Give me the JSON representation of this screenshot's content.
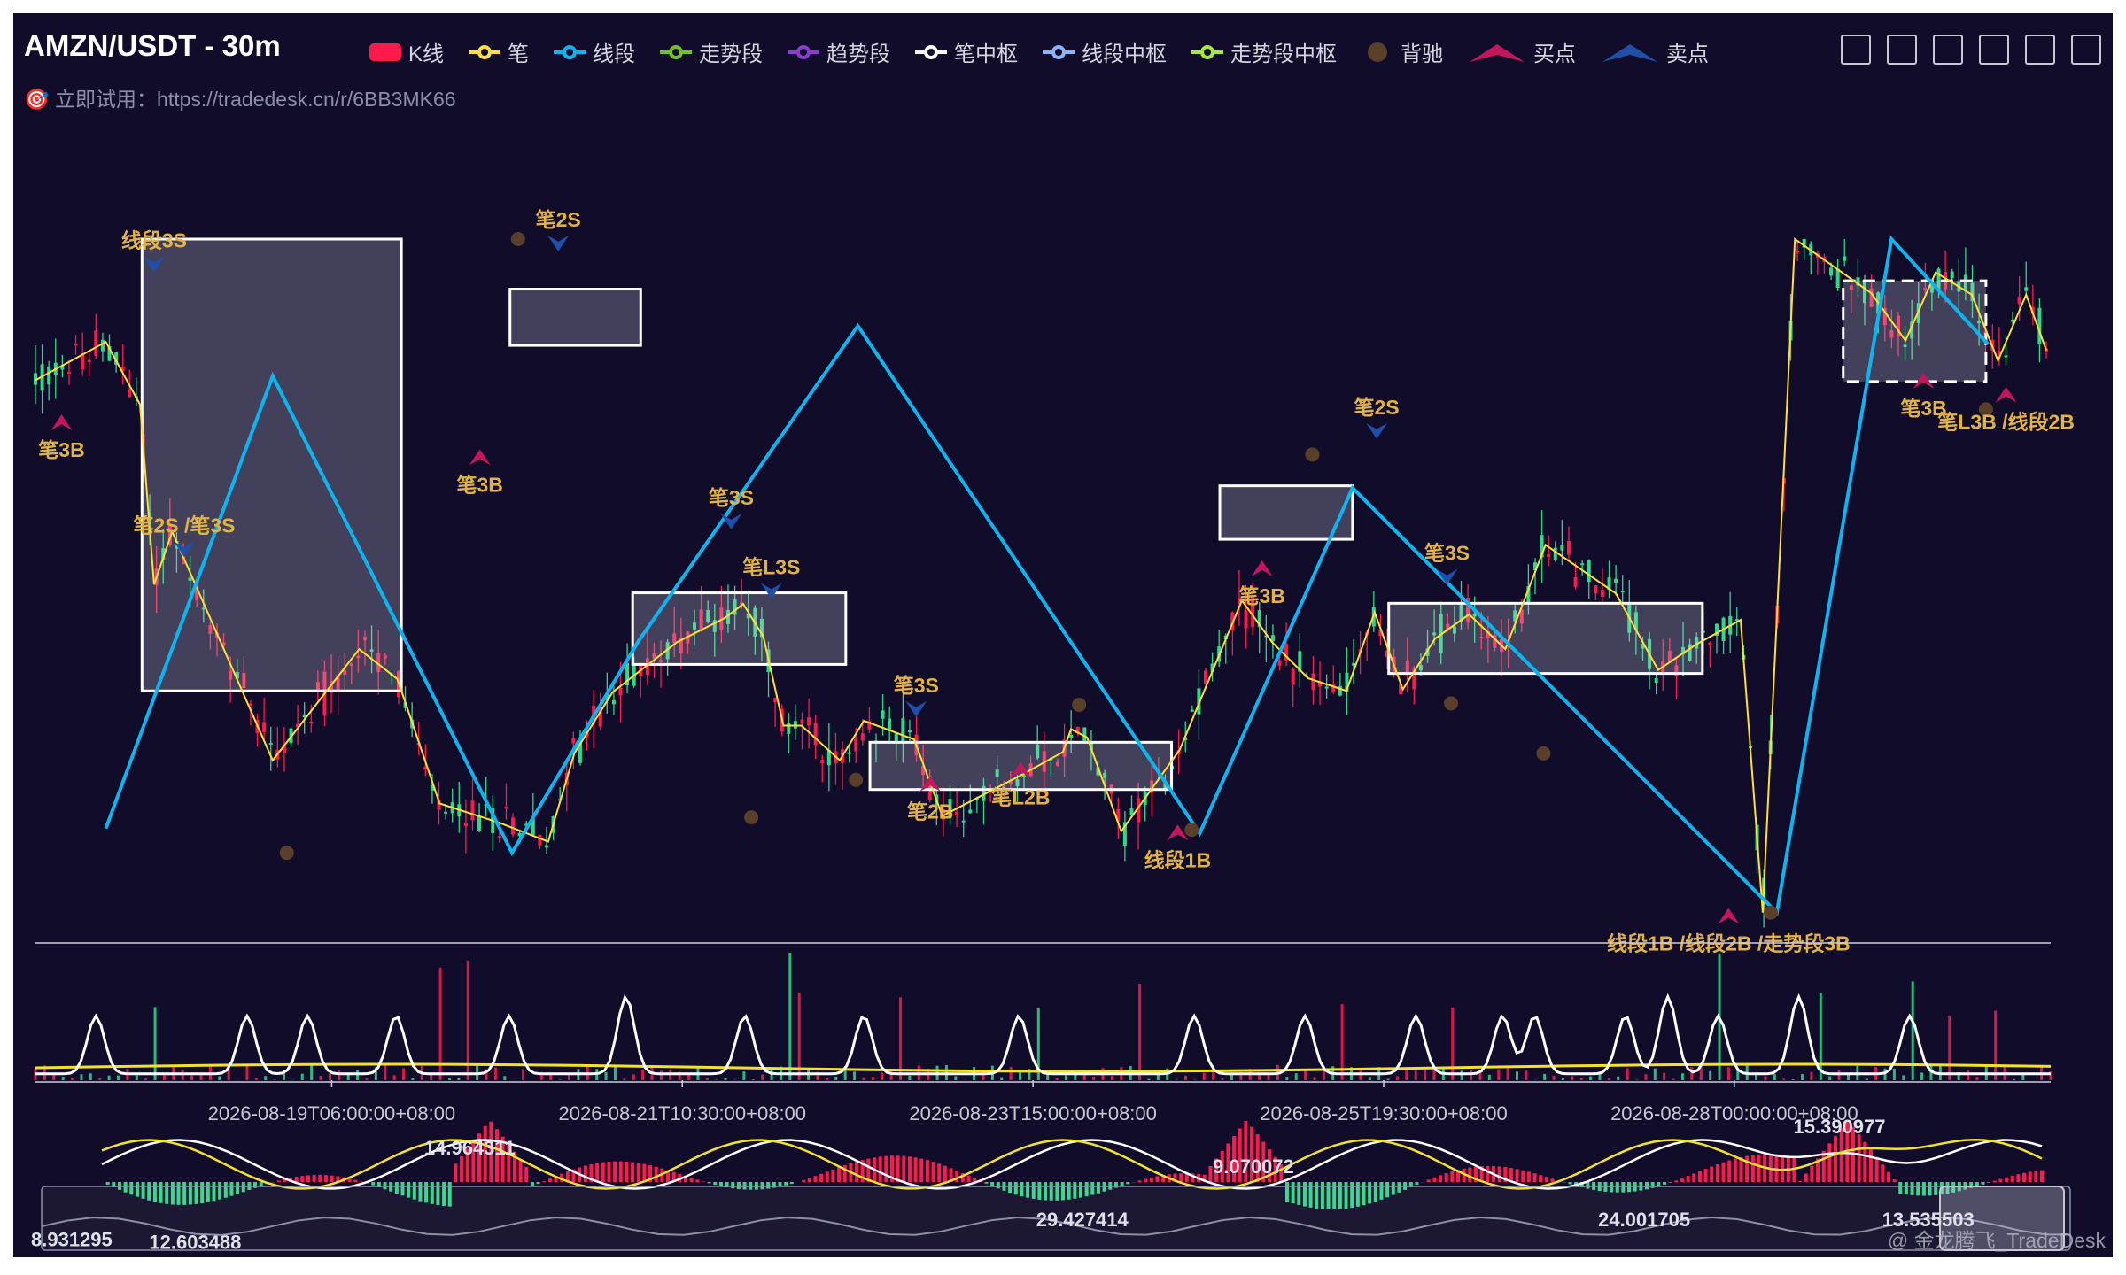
{
  "header": {
    "title": "AMZN/USDT - 30m",
    "subtitle": "🎯 立即试用：https://tradedesk.cn/r/6BB3MK66"
  },
  "legend": [
    {
      "label": "K线",
      "color": "#ff1a4c",
      "kind": "candle"
    },
    {
      "label": "笔",
      "color": "#ffe033",
      "kind": "line"
    },
    {
      "label": "线段",
      "color": "#0db4f0",
      "kind": "line"
    },
    {
      "label": "走势段",
      "color": "#72c02c",
      "kind": "line"
    },
    {
      "label": "趋势段",
      "color": "#8a3ccf",
      "kind": "line"
    },
    {
      "label": "笔中枢",
      "color": "#ffffff",
      "kind": "line"
    },
    {
      "label": "线段中枢",
      "color": "#8ab4f8",
      "kind": "line"
    },
    {
      "label": "走势段中枢",
      "color": "#a6e93a",
      "kind": "line"
    },
    {
      "label": "背驰",
      "color": "#5a3f2a",
      "kind": "dot"
    },
    {
      "label": "买点",
      "color": "#c2185b",
      "kind": "buy"
    },
    {
      "label": "卖点",
      "color": "#1f4fa8",
      "kind": "sell"
    }
  ],
  "toolbox": [
    "zoom-icon",
    "lasso-icon",
    "rect-select-icon",
    "polygon-icon",
    "data-view-icon",
    "reset-icon"
  ],
  "watermark": "@ 金龙腾飞_TradeDesk",
  "colors": {
    "background": "#100c2a",
    "up": "#ff1a4c",
    "down": "#2fd98a",
    "bi": "#ffe033",
    "segment": "#0db4f0",
    "zhongshu": "#ffffff",
    "label": "#e3b341",
    "divergence": "#5a3f2a",
    "buy": "#c2185b",
    "sell": "#1f4fa8"
  },
  "chart_data": {
    "type": "candlestick",
    "x_ticks": [
      "2026-08-19T06:00:00+08:00",
      "2026-08-21T10:30:00+08:00",
      "2026-08-23T15:00:00+08:00",
      "2026-08-25T19:30:00+08:00",
      "2026-08-28T00:00:00+08:00"
    ],
    "x_tick_positions": [
      0.147,
      0.321,
      0.495,
      0.669,
      0.843
    ],
    "segment_path": [
      [
        0.035,
        0.848
      ],
      [
        0.118,
        0.197
      ],
      [
        0.237,
        0.883
      ],
      [
        0.3,
        0.578
      ],
      [
        0.409,
        0.125
      ],
      [
        0.579,
        0.855
      ],
      [
        0.655,
        0.358
      ],
      [
        0.866,
        0.969
      ],
      [
        0.923,
        0.0
      ],
      [
        0.971,
        0.151
      ]
    ],
    "bi_path": [
      [
        0.0,
        0.203
      ],
      [
        0.035,
        0.148
      ],
      [
        0.052,
        0.238
      ],
      [
        0.059,
        0.497
      ],
      [
        0.068,
        0.421
      ],
      [
        0.118,
        0.75
      ],
      [
        0.161,
        0.59
      ],
      [
        0.18,
        0.633
      ],
      [
        0.201,
        0.812
      ],
      [
        0.231,
        0.84
      ],
      [
        0.255,
        0.867
      ],
      [
        0.268,
        0.74
      ],
      [
        0.287,
        0.652
      ],
      [
        0.319,
        0.58
      ],
      [
        0.343,
        0.545
      ],
      [
        0.352,
        0.525
      ],
      [
        0.362,
        0.572
      ],
      [
        0.372,
        0.7
      ],
      [
        0.381,
        0.7
      ],
      [
        0.4,
        0.75
      ],
      [
        0.412,
        0.693
      ],
      [
        0.437,
        0.72
      ],
      [
        0.451,
        0.83
      ],
      [
        0.491,
        0.77
      ],
      [
        0.511,
        0.738
      ],
      [
        0.515,
        0.705
      ],
      [
        0.523,
        0.717
      ],
      [
        0.54,
        0.852
      ],
      [
        0.569,
        0.735
      ],
      [
        0.6,
        0.52
      ],
      [
        0.615,
        0.58
      ],
      [
        0.633,
        0.632
      ],
      [
        0.652,
        0.65
      ],
      [
        0.666,
        0.537
      ],
      [
        0.68,
        0.648
      ],
      [
        0.696,
        0.575
      ],
      [
        0.713,
        0.54
      ],
      [
        0.731,
        0.59
      ],
      [
        0.751,
        0.44
      ],
      [
        0.771,
        0.48
      ],
      [
        0.786,
        0.51
      ],
      [
        0.807,
        0.62
      ],
      [
        0.826,
        0.583
      ],
      [
        0.848,
        0.548
      ],
      [
        0.859,
        0.969
      ],
      [
        0.875,
        0.0
      ],
      [
        0.913,
        0.078
      ],
      [
        0.93,
        0.146
      ],
      [
        0.945,
        0.048
      ],
      [
        0.963,
        0.08
      ],
      [
        0.976,
        0.175
      ],
      [
        0.99,
        0.08
      ],
      [
        1.0,
        0.16
      ]
    ],
    "bi_zhongshu": [
      {
        "x0": 0.053,
        "x1": 0.182,
        "y0": 0.0,
        "y1": 0.65,
        "style": "solid"
      },
      {
        "x0": 0.236,
        "x1": 0.301,
        "y0": 0.072,
        "y1": 0.153,
        "style": "solid"
      },
      {
        "x0": 0.297,
        "x1": 0.403,
        "y0": 0.509,
        "y1": 0.612,
        "style": "solid"
      },
      {
        "x0": 0.415,
        "x1": 0.565,
        "y0": 0.724,
        "y1": 0.792,
        "style": "solid"
      },
      {
        "x0": 0.589,
        "x1": 0.655,
        "y0": 0.355,
        "y1": 0.432,
        "style": "solid"
      },
      {
        "x0": 0.673,
        "x1": 0.829,
        "y0": 0.524,
        "y1": 0.625,
        "style": "solid"
      },
      {
        "x0": 0.899,
        "x1": 0.97,
        "y0": 0.06,
        "y1": 0.205,
        "style": "dashed"
      }
    ],
    "divergence_points": [
      [
        0.24,
        0.0
      ],
      [
        0.125,
        0.883
      ],
      [
        0.356,
        0.832
      ],
      [
        0.408,
        0.778
      ],
      [
        0.519,
        0.67
      ],
      [
        0.575,
        0.85
      ],
      [
        0.635,
        0.31
      ],
      [
        0.704,
        0.668
      ],
      [
        0.75,
        0.74
      ],
      [
        0.863,
        0.969
      ],
      [
        0.97,
        0.245
      ]
    ],
    "signals": [
      {
        "x": 0.013,
        "y": 0.26,
        "type": "buy",
        "label": "笔3B",
        "label_pos": "below"
      },
      {
        "x": 0.059,
        "y": 0.04,
        "type": "sell",
        "label": "线段3S",
        "label_pos": "above"
      },
      {
        "x": 0.074,
        "y": 0.45,
        "type": "sell",
        "label": "笔2S /笔3S",
        "label_pos": "above"
      },
      {
        "x": 0.221,
        "y": 0.31,
        "type": "buy",
        "label": "笔3B",
        "label_pos": "below"
      },
      {
        "x": 0.26,
        "y": 0.01,
        "type": "sell",
        "label": "笔2S",
        "label_pos": "above"
      },
      {
        "x": 0.346,
        "y": 0.41,
        "type": "sell",
        "label": "笔3S",
        "label_pos": "above"
      },
      {
        "x": 0.366,
        "y": 0.51,
        "type": "sell",
        "label": "笔L3S",
        "label_pos": "above"
      },
      {
        "x": 0.438,
        "y": 0.68,
        "type": "sell",
        "label": "笔3S",
        "label_pos": "above"
      },
      {
        "x": 0.445,
        "y": 0.78,
        "type": "buy",
        "label": "笔2B",
        "label_pos": "below"
      },
      {
        "x": 0.49,
        "y": 0.76,
        "type": "buy",
        "label": "笔L2B",
        "label_pos": "below"
      },
      {
        "x": 0.568,
        "y": 0.85,
        "type": "buy",
        "label": "线段1B",
        "label_pos": "below"
      },
      {
        "x": 0.61,
        "y": 0.47,
        "type": "buy",
        "label": "笔3B",
        "label_pos": "below"
      },
      {
        "x": 0.667,
        "y": 0.28,
        "type": "sell",
        "label": "笔2S",
        "label_pos": "above"
      },
      {
        "x": 0.702,
        "y": 0.49,
        "type": "sell",
        "label": "笔3S",
        "label_pos": "above"
      },
      {
        "x": 0.842,
        "y": 0.97,
        "type": "buy",
        "label": "线段1B /线段2B /走势段3B",
        "label_pos": "below"
      },
      {
        "x": 0.939,
        "y": 0.2,
        "type": "buy",
        "label": "笔3B",
        "label_pos": "below"
      },
      {
        "x": 0.98,
        "y": 0.22,
        "type": "buy",
        "label": "笔L3B /线段2B",
        "label_pos": "below"
      }
    ],
    "macd_labels": [
      {
        "x": 0.0,
        "y": 0.95,
        "text": "8.931295"
      },
      {
        "x": 0.193,
        "y": 0.26,
        "text": "14.964311"
      },
      {
        "x": 0.058,
        "y": 0.97,
        "text": "12.603488"
      },
      {
        "x": 0.58,
        "y": 0.4,
        "text": "9.070072"
      },
      {
        "x": 0.865,
        "y": 0.1,
        "text": "15.390977"
      }
    ],
    "slider_labels": [
      {
        "x": 0.513,
        "text": "29.427414"
      },
      {
        "x": 0.79,
        "text": "24.001705"
      },
      {
        "x": 0.93,
        "text": "13.535503"
      }
    ]
  }
}
